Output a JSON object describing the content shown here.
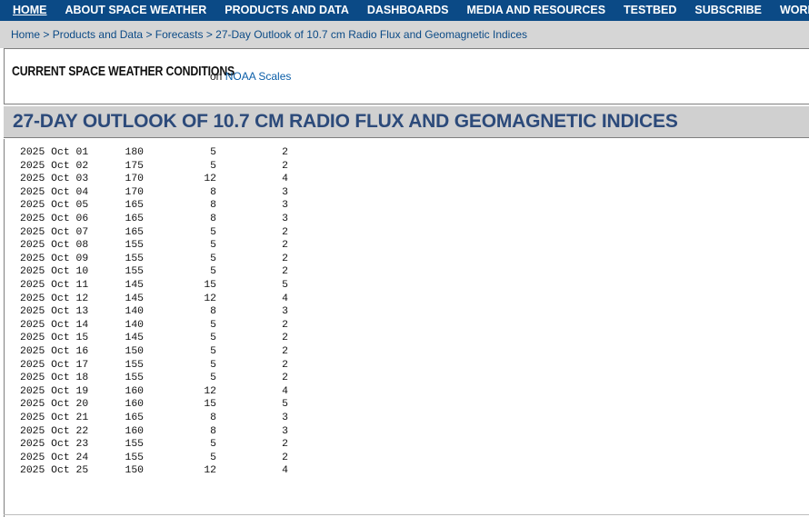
{
  "nav": {
    "items": [
      "HOME",
      "ABOUT SPACE WEATHER",
      "PRODUCTS AND DATA",
      "DASHBOARDS",
      "MEDIA AND RESOURCES",
      "TESTBED",
      "SUBSCRIBE",
      "WORKSHOP"
    ]
  },
  "breadcrumb": {
    "items": [
      "Home",
      "Products and Data",
      "Forecasts",
      "27-Day Outlook of 10.7 cm Radio Flux and Geomagnetic Indices"
    ],
    "separator": ">"
  },
  "conditions": {
    "title": "CURRENT SPACE WEATHER CONDITIONS",
    "on_text": "on",
    "link": "NOAA Scales"
  },
  "page_title": "27-DAY OUTLOOK OF 10.7 CM RADIO FLUX AND GEOMAGNETIC INDICES",
  "table": {
    "rows": [
      {
        "date": "2025 Oct 01",
        "flux": "180",
        "ap": "5",
        "kp": "2"
      },
      {
        "date": "2025 Oct 02",
        "flux": "175",
        "ap": "5",
        "kp": "2"
      },
      {
        "date": "2025 Oct 03",
        "flux": "170",
        "ap": "12",
        "kp": "4"
      },
      {
        "date": "2025 Oct 04",
        "flux": "170",
        "ap": "8",
        "kp": "3"
      },
      {
        "date": "2025 Oct 05",
        "flux": "165",
        "ap": "8",
        "kp": "3"
      },
      {
        "date": "2025 Oct 06",
        "flux": "165",
        "ap": "8",
        "kp": "3"
      },
      {
        "date": "2025 Oct 07",
        "flux": "165",
        "ap": "5",
        "kp": "2"
      },
      {
        "date": "2025 Oct 08",
        "flux": "155",
        "ap": "5",
        "kp": "2"
      },
      {
        "date": "2025 Oct 09",
        "flux": "155",
        "ap": "5",
        "kp": "2"
      },
      {
        "date": "2025 Oct 10",
        "flux": "155",
        "ap": "5",
        "kp": "2"
      },
      {
        "date": "2025 Oct 11",
        "flux": "145",
        "ap": "15",
        "kp": "5"
      },
      {
        "date": "2025 Oct 12",
        "flux": "145",
        "ap": "12",
        "kp": "4"
      },
      {
        "date": "2025 Oct 13",
        "flux": "140",
        "ap": "8",
        "kp": "3"
      },
      {
        "date": "2025 Oct 14",
        "flux": "140",
        "ap": "5",
        "kp": "2"
      },
      {
        "date": "2025 Oct 15",
        "flux": "145",
        "ap": "5",
        "kp": "2"
      },
      {
        "date": "2025 Oct 16",
        "flux": "150",
        "ap": "5",
        "kp": "2"
      },
      {
        "date": "2025 Oct 17",
        "flux": "155",
        "ap": "5",
        "kp": "2"
      },
      {
        "date": "2025 Oct 18",
        "flux": "155",
        "ap": "5",
        "kp": "2"
      },
      {
        "date": "2025 Oct 19",
        "flux": "160",
        "ap": "12",
        "kp": "4"
      },
      {
        "date": "2025 Oct 20",
        "flux": "160",
        "ap": "15",
        "kp": "5"
      },
      {
        "date": "2025 Oct 21",
        "flux": "165",
        "ap": "8",
        "kp": "3"
      },
      {
        "date": "2025 Oct 22",
        "flux": "160",
        "ap": "8",
        "kp": "3"
      },
      {
        "date": "2025 Oct 23",
        "flux": "155",
        "ap": "5",
        "kp": "2"
      },
      {
        "date": "2025 Oct 24",
        "flux": "155",
        "ap": "5",
        "kp": "2"
      },
      {
        "date": "2025 Oct 25",
        "flux": "150",
        "ap": "12",
        "kp": "4"
      }
    ]
  }
}
